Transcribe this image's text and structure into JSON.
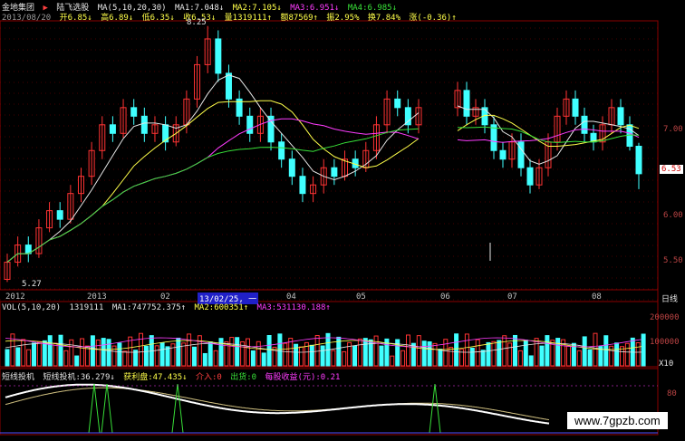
{
  "header": {
    "stock_name": "金地集团",
    "indicator_marker": "▶",
    "price_label": "陆飞选股",
    "ma_setting": "MA(5,10,20,30)",
    "ma1": "MA1:7.048↓",
    "ma2": "MA2:7.105↓",
    "ma3": "MA3:6.951↓",
    "ma4": "MA4:6.985↓"
  },
  "info_bar": {
    "date": "2013/08/20",
    "open": "开6.85↓",
    "high": "高6.89↓",
    "low": "低6.35↓",
    "close": "收6.53↓",
    "volume": "量1319111↑",
    "amount": "额87569↑",
    "amplitude": "振2.95%",
    "turnover": "换7.84%",
    "change": "涨(-0.36)↑"
  },
  "price_axis": {
    "ticks": [
      "7.00",
      "6.50",
      "6.00",
      "5.50"
    ],
    "current": "6.53",
    "high_mark": "8.25",
    "low_mark": "5.27"
  },
  "date_axis": {
    "labels": [
      "2012",
      "2013",
      "02",
      "04",
      "05",
      "06",
      "07",
      "08"
    ],
    "selected_range": "13/02/25, 一",
    "period": "日线"
  },
  "volume_panel": {
    "setting": "VOL(5,10,20)",
    "value": "1319111",
    "ma1": "MA1:747752.375↑",
    "ma2": "MA2:600351↑",
    "ma3": "MA3:531130.188↑",
    "ticks": [
      "200000",
      "100000"
    ],
    "unit": "X10"
  },
  "indicator_panel": {
    "name": "短线投机",
    "value": "短线投机:36.279↓",
    "profit": "获利盘:47.435↓",
    "buy": "介入:0",
    "sell": "出货:0",
    "eps": "每股收益(元):0.21",
    "tick": "80"
  },
  "watermark": "www.7gpzb.com",
  "colors": {
    "up": "#ff3333",
    "down": "#40ffff",
    "ma1": "#e6e6e6",
    "ma2": "#ffff4a",
    "ma3": "#ff3cff",
    "ma4": "#38e038",
    "grid": "#8b0000"
  },
  "chart_data": {
    "type": "candlestick",
    "note_series": "visible price region daily candles (approximate)",
    "y_range": [
      5.2,
      8.3
    ],
    "candles": [
      [
        5.3,
        5.5,
        5.27,
        5.6
      ],
      [
        5.5,
        5.7,
        5.45,
        5.8
      ],
      [
        5.7,
        5.6,
        5.5,
        5.8
      ],
      [
        5.6,
        5.9,
        5.55,
        6.0
      ],
      [
        5.9,
        6.1,
        5.85,
        6.2
      ],
      [
        6.1,
        6.0,
        5.9,
        6.2
      ],
      [
        6.0,
        6.3,
        5.95,
        6.4
      ],
      [
        6.3,
        6.5,
        6.2,
        6.6
      ],
      [
        6.5,
        6.8,
        6.4,
        6.9
      ],
      [
        6.8,
        7.1,
        6.7,
        7.2
      ],
      [
        7.1,
        7.0,
        6.9,
        7.2
      ],
      [
        7.0,
        7.3,
        6.95,
        7.4
      ],
      [
        7.3,
        7.2,
        7.1,
        7.4
      ],
      [
        7.2,
        7.0,
        6.9,
        7.3
      ],
      [
        7.0,
        7.1,
        6.9,
        7.2
      ],
      [
        7.1,
        6.9,
        6.8,
        7.2
      ],
      [
        6.9,
        7.1,
        6.85,
        7.2
      ],
      [
        7.1,
        7.4,
        7.0,
        7.5
      ],
      [
        7.4,
        7.8,
        7.3,
        7.9
      ],
      [
        7.8,
        8.1,
        7.7,
        8.25
      ],
      [
        8.1,
        7.7,
        7.6,
        8.2
      ],
      [
        7.7,
        7.4,
        7.3,
        7.8
      ],
      [
        7.4,
        7.2,
        7.1,
        7.5
      ],
      [
        7.2,
        7.0,
        6.9,
        7.3
      ],
      [
        7.0,
        7.2,
        6.9,
        7.3
      ],
      [
        7.2,
        6.9,
        6.8,
        7.3
      ],
      [
        6.9,
        6.7,
        6.6,
        7.0
      ],
      [
        6.7,
        6.5,
        6.4,
        6.8
      ],
      [
        6.5,
        6.3,
        6.2,
        6.6
      ],
      [
        6.3,
        6.4,
        6.2,
        6.5
      ],
      [
        6.4,
        6.6,
        6.3,
        6.7
      ],
      [
        6.6,
        6.5,
        6.4,
        6.7
      ],
      [
        6.5,
        6.7,
        6.45,
        6.8
      ],
      [
        6.7,
        6.6,
        6.5,
        6.8
      ],
      [
        6.6,
        6.8,
        6.55,
        6.9
      ],
      [
        6.8,
        7.1,
        6.7,
        7.2
      ],
      [
        7.1,
        7.4,
        7.0,
        7.5
      ],
      [
        7.4,
        7.3,
        7.2,
        7.5
      ],
      [
        7.3,
        7.1,
        7.0,
        7.4
      ],
      [
        7.1,
        7.3,
        7.0,
        7.4
      ],
      [
        7.3,
        7.5,
        7.2,
        7.6
      ],
      [
        7.5,
        7.2,
        7.1,
        7.6
      ],
      [
        7.2,
        7.3,
        7.1,
        7.4
      ],
      [
        7.3,
        7.1,
        7.0,
        7.4
      ],
      [
        7.1,
        6.8,
        6.7,
        7.2
      ],
      [
        6.8,
        6.7,
        6.6,
        6.9
      ],
      [
        6.7,
        6.9,
        6.6,
        7.0
      ],
      [
        6.9,
        6.6,
        6.5,
        7.0
      ],
      [
        6.6,
        6.4,
        6.3,
        6.7
      ],
      [
        6.4,
        6.6,
        6.35,
        6.7
      ],
      [
        6.6,
        6.9,
        6.5,
        7.0
      ],
      [
        6.9,
        7.2,
        6.8,
        7.3
      ],
      [
        7.2,
        7.4,
        7.1,
        7.5
      ],
      [
        7.4,
        7.2,
        7.1,
        7.5
      ],
      [
        7.2,
        7.0,
        6.9,
        7.3
      ],
      [
        7.0,
        6.9,
        6.8,
        7.1
      ],
      [
        6.9,
        7.1,
        6.8,
        7.2
      ],
      [
        7.1,
        7.3,
        7.0,
        7.4
      ],
      [
        7.3,
        7.1,
        7.0,
        7.4
      ],
      [
        7.1,
        6.85,
        6.8,
        7.2
      ],
      [
        6.85,
        6.53,
        6.35,
        6.89
      ]
    ]
  }
}
